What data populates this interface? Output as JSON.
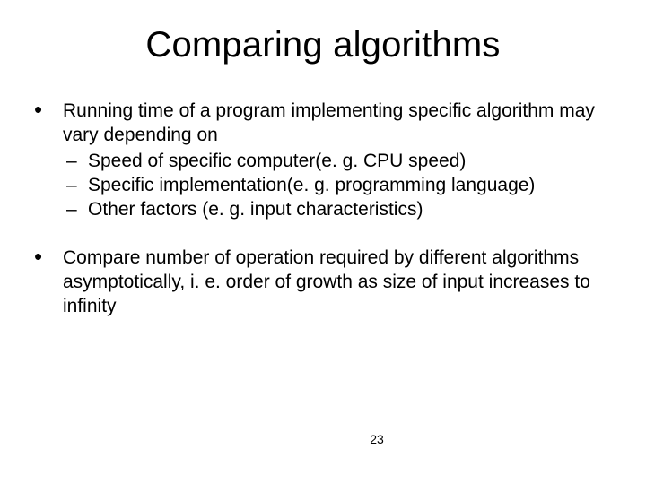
{
  "slide": {
    "title": "Comparing algorithms",
    "bullet1": {
      "lead": " Running time of a program implementing specific algorithm may vary depending on",
      "sub": [
        "Speed of specific computer(e. g. CPU speed)",
        "Specific implementation(e. g. programming language)",
        "Other factors (e. g. input characteristics)"
      ]
    },
    "bullet2": "Compare number of operation required by different algorithms asymptotically, i. e. order of growth as size of input increases to infinity",
    "page_number": "23"
  }
}
